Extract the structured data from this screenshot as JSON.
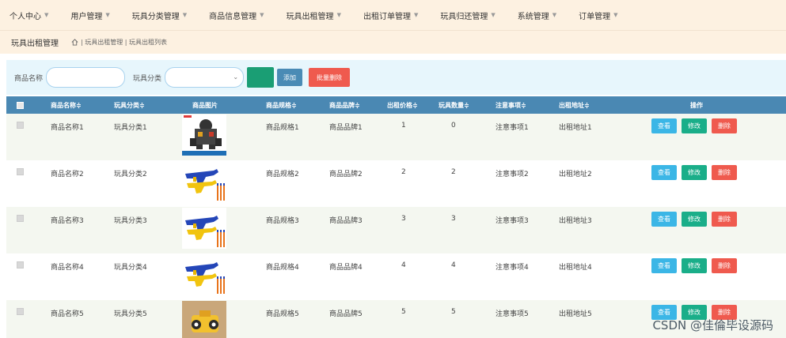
{
  "nav": {
    "items": [
      {
        "label": "个人中心"
      },
      {
        "label": "用户管理"
      },
      {
        "label": "玩具分类管理"
      },
      {
        "label": "商品信息管理"
      },
      {
        "label": "玩具出租管理"
      },
      {
        "label": "出租订单管理"
      },
      {
        "label": "玩具归还管理"
      },
      {
        "label": "系统管理"
      },
      {
        "label": "订单管理"
      }
    ]
  },
  "breadcrumb": {
    "title": "玩具出租管理",
    "path": "| 玩具出租管理 | 玩具出租列表"
  },
  "search": {
    "name_label": "商品名称",
    "name_value": "",
    "category_label": "玩具分类",
    "category_value": "",
    "add_label": "添加",
    "batch_delete_label": "批量删除"
  },
  "table": {
    "headers": {
      "name": "商品名称≑",
      "category": "玩具分类≑",
      "image": "商品图片",
      "spec": "商品规格≑",
      "brand": "商品品牌≑",
      "price": "出租价格≑",
      "quantity": "玩具数量≑",
      "notes": "注意事项≑",
      "address": "出租地址≑",
      "ops": "操作"
    },
    "rows": [
      {
        "name": "商品名称1",
        "category": "玩具分类1",
        "image": "toy-robot",
        "spec": "商品规格1",
        "brand": "商品品牌1",
        "price": "1",
        "quantity": "0",
        "notes": "注意事项1",
        "address": "出租地址1"
      },
      {
        "name": "商品名称2",
        "category": "玩具分类2",
        "image": "toy-gun",
        "spec": "商品规格2",
        "brand": "商品品牌2",
        "price": "2",
        "quantity": "2",
        "notes": "注意事项2",
        "address": "出租地址2"
      },
      {
        "name": "商品名称3",
        "category": "玩具分类3",
        "image": "toy-gun",
        "spec": "商品规格3",
        "brand": "商品品牌3",
        "price": "3",
        "quantity": "3",
        "notes": "注意事项3",
        "address": "出租地址3"
      },
      {
        "name": "商品名称4",
        "category": "玩具分类4",
        "image": "toy-gun",
        "spec": "商品规格4",
        "brand": "商品品牌4",
        "price": "4",
        "quantity": "4",
        "notes": "注意事项4",
        "address": "出租地址4"
      },
      {
        "name": "商品名称5",
        "category": "玩具分类5",
        "image": "toy-car",
        "spec": "商品规格5",
        "brand": "商品品牌5",
        "price": "5",
        "quantity": "5",
        "notes": "注意事项5",
        "address": "出租地址5"
      }
    ],
    "actions": {
      "view": "查看",
      "edit": "修改",
      "delete": "删除"
    }
  },
  "watermark": "CSDN @佳倫毕设源码",
  "colors": {
    "nav_bg": "#fdf1e1",
    "toolbar_bg": "#e7f6fc",
    "header_bg": "#4a88b3",
    "view": "#3bb6e6",
    "edit": "#1aae89",
    "delete": "#ef5a4e",
    "search_btn": "#1a9e74"
  }
}
